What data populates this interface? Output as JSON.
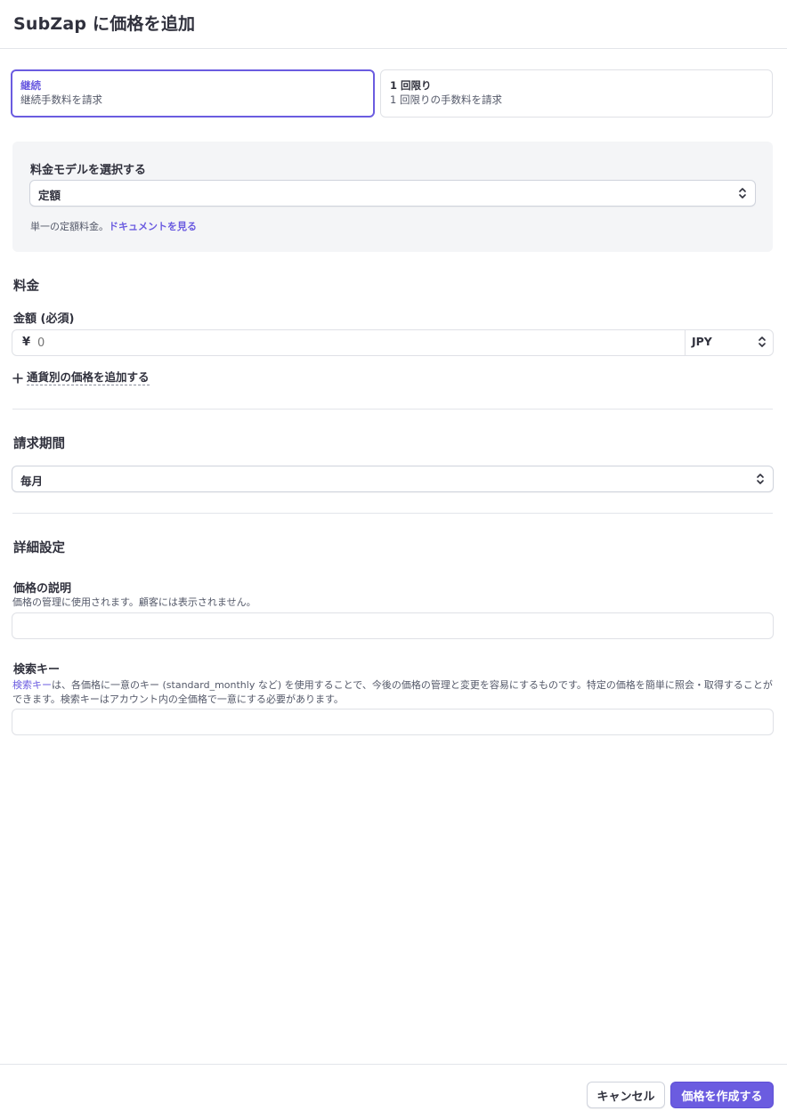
{
  "header": {
    "title": "SubZap に価格を追加"
  },
  "price_type": {
    "options": [
      {
        "title": "継続",
        "desc": "継続手数料を請求",
        "selected": true
      },
      {
        "title": "1 回限り",
        "desc": "1 回限りの手数料を請求",
        "selected": false
      }
    ]
  },
  "pricing_model": {
    "label": "料金モデルを選択する",
    "value": "定額",
    "help": "単一の定額料金。",
    "doc_link": "ドキュメントを見る"
  },
  "price": {
    "section_title": "料金",
    "amount_label": "金額 (必須)",
    "currency_symbol": "¥",
    "amount_placeholder": "0",
    "currency": "JPY",
    "add_currency_link": "通貨別の価格を追加する"
  },
  "billing": {
    "section_title": "請求期間",
    "value": "毎月"
  },
  "advanced": {
    "section_title": "詳細設定",
    "description_label": "価格の説明",
    "description_help": "価格の管理に使用されます。顧客には表示されません。",
    "description_value": "",
    "lookup_label": "検索キー",
    "lookup_help_link": "検索キー",
    "lookup_help": "は、各価格に一意のキー (standard_monthly など) を使用することで、今後の価格の管理と変更を容易にするものです。特定の価格を簡単に照会・取得することができます。検索キーはアカウント内の全価格で一意にする必要があります。",
    "lookup_value": ""
  },
  "footer": {
    "cancel_label": "キャンセル",
    "create_label": "価格を作成する"
  },
  "colors": {
    "accent": "#6b5ce0",
    "text": "#30313d",
    "muted": "#545969",
    "panel": "#f4f5f7"
  }
}
